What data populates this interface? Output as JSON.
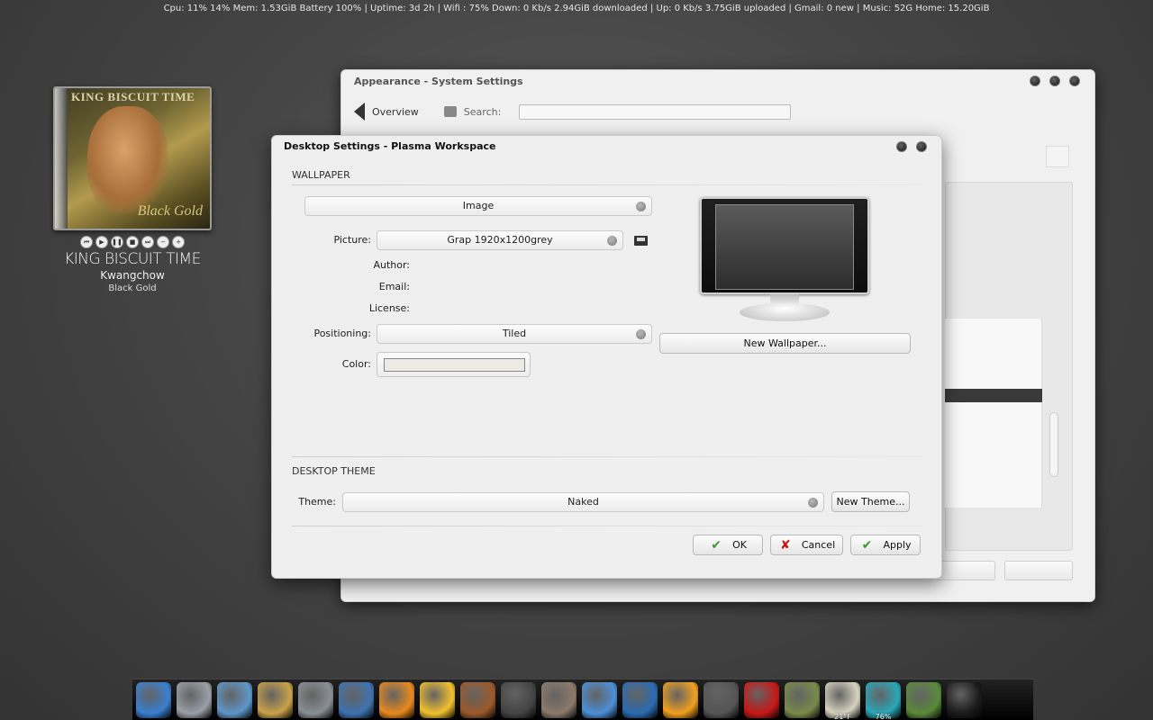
{
  "statusbar": {
    "text": "Cpu: 11% 14%   Mem: 1.53GiB Battery 100%   |  Uptime: 3d 2h   |  Wifi : 75%   Down: 0 Kb/s   2.94GiB downloaded   |  Up:  0 Kb/s   3.75GiB uploaded   | Gmail: 0 new   |  Music: 52G   Home: 15.20GiB"
  },
  "nowplaying": {
    "cover_top_text": "KING BISCUIT TIME",
    "cover_bottom_text": "Black Gold",
    "title": "KING BISCUIT TIME",
    "artist": "Kwangchow",
    "album": "Black Gold",
    "controls": [
      "previous",
      "play",
      "pause",
      "stop",
      "next",
      "minus",
      "plus"
    ]
  },
  "back_window": {
    "title": "Appearance - System Settings",
    "overview_label": "Overview",
    "search_label": "Search:",
    "search_value": ""
  },
  "dialog": {
    "title": "Desktop Settings - Plasma Workspace",
    "wallpaper_section": "WALLPAPER",
    "wallpaper_type": "Image",
    "picture_label": "Picture:",
    "picture_value": "Grap 1920x1200grey",
    "author_label": "Author:",
    "email_label": "Email:",
    "license_label": "License:",
    "positioning_label": "Positioning:",
    "positioning_value": "Tiled",
    "color_label": "Color:",
    "color_value": "#ecebe3",
    "new_wallpaper_button": "New Wallpaper...",
    "theme_section": "DESKTOP THEME",
    "theme_label": "Theme:",
    "theme_value": "Naked",
    "new_theme_button": "New Theme...",
    "ok_button": "OK",
    "cancel_button": "Cancel",
    "apply_button": "Apply"
  },
  "dock": {
    "items": [
      {
        "name": "media-player-icon",
        "color": "#3a7fd0",
        "label": ""
      },
      {
        "name": "system-tools-icon",
        "color": "#9aa0a8",
        "label": ""
      },
      {
        "name": "image-viewer-icon",
        "color": "#5f97c9",
        "label": ""
      },
      {
        "name": "office-icon",
        "color": "#c9a24a",
        "label": ""
      },
      {
        "name": "screenshot-icon",
        "color": "#8a8f96",
        "label": ""
      },
      {
        "name": "python-icon",
        "color": "#3f73b0",
        "label": ""
      },
      {
        "name": "rss-feed-icon",
        "color": "#e98a1f",
        "label": ""
      },
      {
        "name": "tux-penguin-icon",
        "color": "#f2c12e",
        "label": ""
      },
      {
        "name": "guitar-icon",
        "color": "#9c5a2a",
        "label": ""
      },
      {
        "name": "lastfm-icon",
        "color": "#444444",
        "label": ""
      },
      {
        "name": "film-icon",
        "color": "#8c7a6a",
        "label": ""
      },
      {
        "name": "network-globe-icon",
        "color": "#4d8fd6",
        "label": ""
      },
      {
        "name": "browser-icon",
        "color": "#2a6bb2",
        "label": ""
      },
      {
        "name": "flame-icon",
        "color": "#f0a020",
        "label": ""
      },
      {
        "name": "headphones-icon",
        "color": "#555555",
        "label": ""
      },
      {
        "name": "opera-icon",
        "color": "#c81818",
        "label": ""
      },
      {
        "name": "system-monitor-icon",
        "color": "#7a8a4a",
        "label": ""
      },
      {
        "name": "weather-icon",
        "color": "#d8d2c0",
        "label": "21°F"
      },
      {
        "name": "wifi-globe-icon",
        "color": "#2aa8b8",
        "label": "76%"
      },
      {
        "name": "garden-icon",
        "color": "#5a8a3a",
        "label": ""
      },
      {
        "name": "shutdown-icon",
        "color": "#1a1a1a",
        "label": ""
      }
    ]
  }
}
